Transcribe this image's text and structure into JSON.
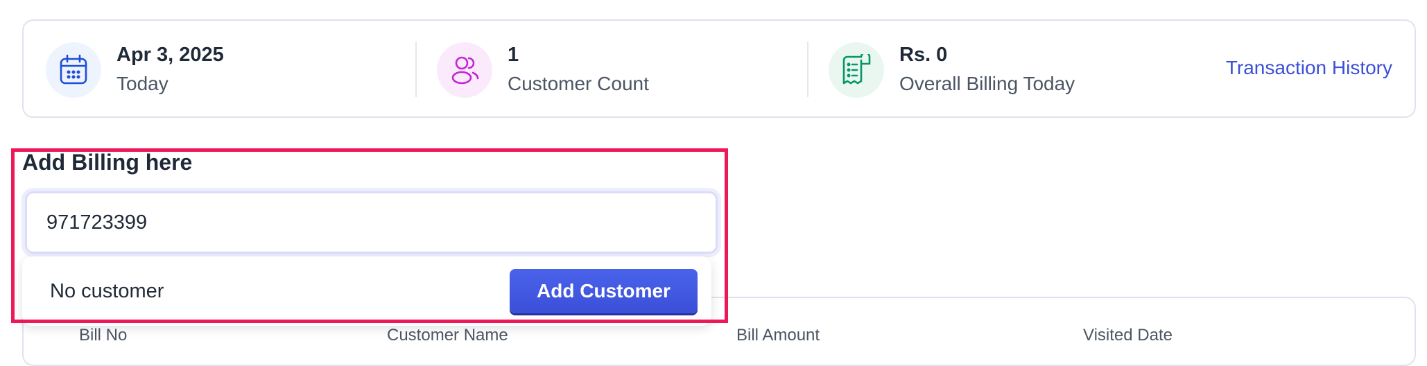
{
  "stats": {
    "date": {
      "value": "Apr 3, 2025",
      "label": "Today",
      "icon": "calendar-icon"
    },
    "customers": {
      "value": "1",
      "label": "Customer Count",
      "icon": "users-icon"
    },
    "billing": {
      "value": "Rs. 0",
      "label": "Overall Billing Today",
      "icon": "receipt-icon"
    },
    "transaction_link": "Transaction History"
  },
  "billing_form": {
    "title": "Add Billing here",
    "input_value": "971723399",
    "dropdown": {
      "message": "No customer",
      "add_button": "Add Customer"
    }
  },
  "table": {
    "headers": [
      "Bill No",
      "Customer Name",
      "Bill Amount",
      "Visited Date"
    ]
  },
  "colors": {
    "accent": "#3b4fd8",
    "highlight_border": "#ee1758",
    "calendar_icon_bg": "#eef4fd",
    "users_icon_bg": "#fbeafc",
    "receipt_icon_bg": "#e9f7f0"
  }
}
